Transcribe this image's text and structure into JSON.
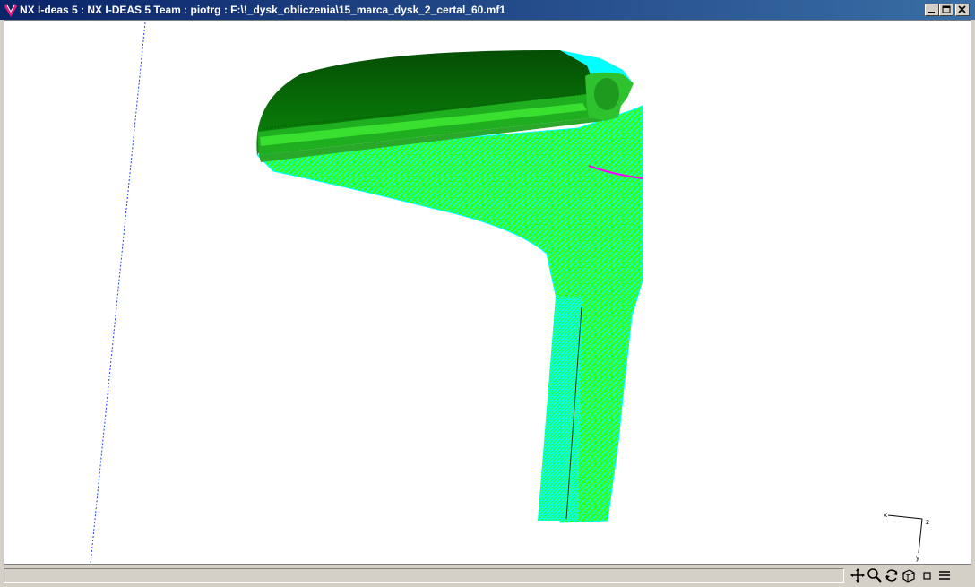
{
  "window": {
    "title": "NX I-deas 5 :    NX I-DEAS 5 Team : piotrg : F:\\!_dysk_obliczenia\\15_marca_dysk_2_certal_60.mf1",
    "buttons": [
      "minimize",
      "maximize",
      "close"
    ]
  },
  "viewport": {
    "background": "#ffffff",
    "model_colors": {
      "dark_surface": "#0a6a0a",
      "mid_surface": "#22c022",
      "light_surface": "#39ff14",
      "mesh": "#00ffff",
      "accent": "#ff00ff"
    },
    "triad": {
      "x_label": "x",
      "y_label": "y",
      "z_label": "z"
    }
  },
  "statusbar": {
    "text": "",
    "tools": [
      "pan-icon",
      "zoom-icon",
      "rotate-icon",
      "view-orient-icon",
      "fit-icon",
      "menu-icon"
    ]
  }
}
